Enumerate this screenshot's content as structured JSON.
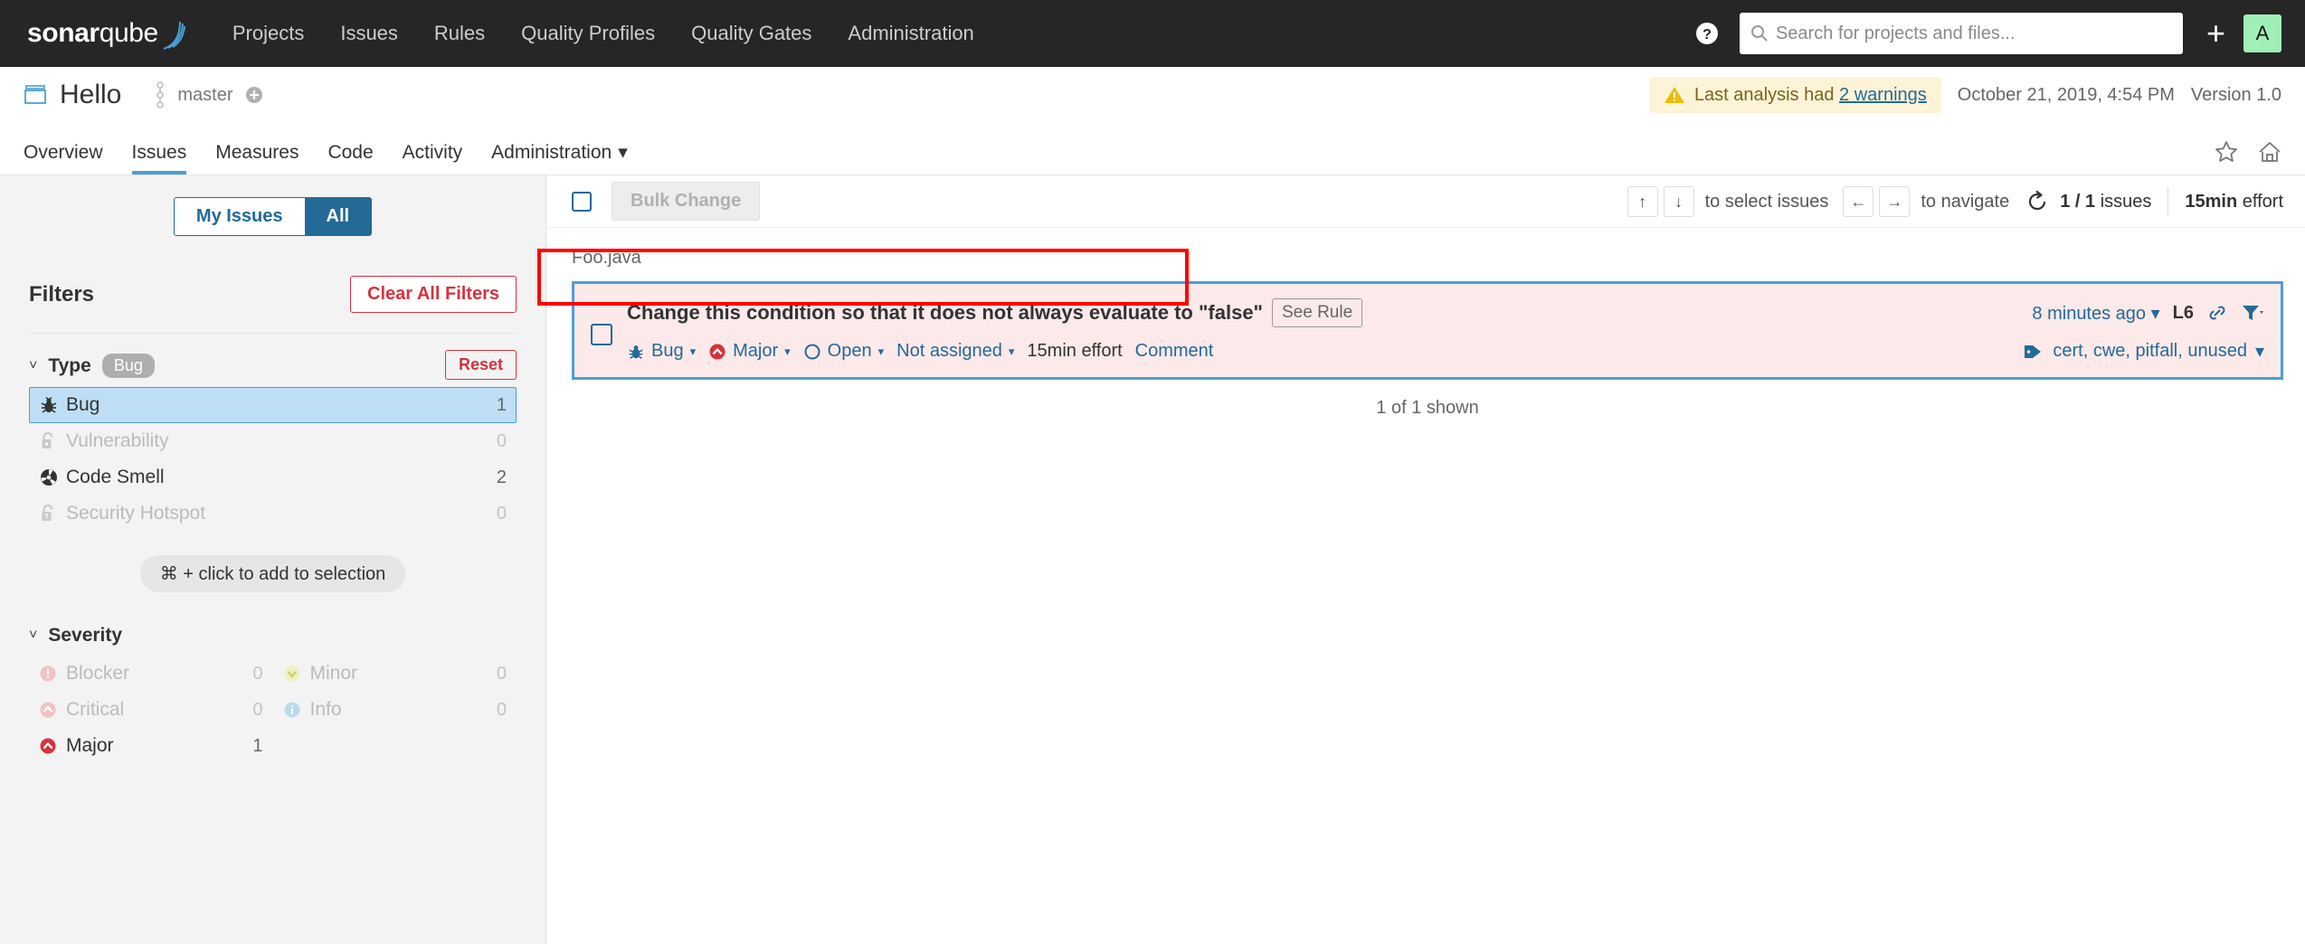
{
  "global_nav": {
    "logo_bold": "sonar",
    "logo_light": "qube",
    "links": [
      {
        "label": "Projects"
      },
      {
        "label": "Issues"
      },
      {
        "label": "Rules"
      },
      {
        "label": "Quality Profiles"
      },
      {
        "label": "Quality Gates"
      },
      {
        "label": "Administration"
      }
    ],
    "help_icon": "help-circle-icon",
    "search": {
      "icon": "search-icon",
      "placeholder": "Search for projects and files...",
      "value": ""
    },
    "plus_label": "+",
    "avatar_initial": "A",
    "avatar_color": "#9ff0b8",
    "background": "#262626"
  },
  "project_header": {
    "icon": "project-icon",
    "title": "Hello",
    "branch_icon": "branch-icon",
    "branch": "master",
    "branch_add_icon": "plus-circle-icon",
    "warning": {
      "icon": "warning-triangle-icon",
      "prefix": "Last analysis had ",
      "link": "2 warnings",
      "bg": "#fdf3d7"
    },
    "analysis_date": "October 21, 2019, 4:54 PM",
    "version": "Version 1.0"
  },
  "tabs": {
    "items": [
      {
        "label": "Overview",
        "active": false
      },
      {
        "label": "Issues",
        "active": true
      },
      {
        "label": "Measures",
        "active": false
      },
      {
        "label": "Code",
        "active": false
      },
      {
        "label": "Activity",
        "active": false
      },
      {
        "label": "Administration",
        "active": false,
        "caret": "▾"
      }
    ],
    "favorite_icon": "star-icon",
    "home_icon": "home-icon",
    "active_color": "#4b9fd5"
  },
  "sidebar": {
    "toggle": {
      "my_issues": "My Issues",
      "all": "All",
      "active": "All",
      "accent": "#236a97"
    },
    "filters_title": "Filters",
    "clear_all": "Clear All Filters",
    "clear_color": "#d4333f",
    "type_facet": {
      "name": "Type",
      "chevron": "˅",
      "chip": "Bug",
      "reset": "Reset",
      "items": [
        {
          "label": "Bug",
          "count": "1",
          "icon": "bug-icon",
          "selected": true,
          "disabled": false
        },
        {
          "label": "Vulnerability",
          "count": "0",
          "icon": "vulnerability-lock-icon",
          "selected": false,
          "disabled": true
        },
        {
          "label": "Code Smell",
          "count": "2",
          "icon": "code-smell-icon",
          "selected": false,
          "disabled": false
        },
        {
          "label": "Security Hotspot",
          "count": "0",
          "icon": "security-hotspot-icon",
          "selected": false,
          "disabled": true
        }
      ]
    },
    "hint": "⌘ + click to add to selection",
    "severity_facet": {
      "name": "Severity",
      "chevron": "˅",
      "items": [
        {
          "label": "Blocker",
          "count": "0",
          "icon": "blocker-icon",
          "disabled": true
        },
        {
          "label": "Minor",
          "count": "0",
          "icon": "minor-icon",
          "disabled": true
        },
        {
          "label": "Critical",
          "count": "0",
          "icon": "critical-icon",
          "disabled": true
        },
        {
          "label": "Info",
          "count": "0",
          "icon": "info-icon",
          "disabled": true
        },
        {
          "label": "Major",
          "count": "1",
          "icon": "major-icon",
          "disabled": false
        }
      ]
    }
  },
  "toolbar": {
    "select_all_checkbox": "",
    "bulk_change": "Bulk Change",
    "key_up": "↑",
    "key_down": "↓",
    "select_hint": "to select issues",
    "key_left": "←",
    "key_right": "→",
    "navigate_hint": "to navigate",
    "reload_icon": "reload-icon",
    "issues_count": "1 / 1",
    "issues_word": "issues",
    "effort_value": "15min",
    "effort_word": "effort"
  },
  "issue_list": {
    "file_name": "Foo.java",
    "issue": {
      "message": "Change this condition so that it does not always evaluate to \"false\"",
      "see_rule": "See Rule",
      "updated": "8 minutes ago",
      "line": "L6",
      "permalink_icon": "link-icon",
      "filter_icon": "filter-icon",
      "type": {
        "label": "Bug",
        "icon": "bug-icon"
      },
      "severity": {
        "label": "Major",
        "icon": "major-icon"
      },
      "status": {
        "label": "Open",
        "icon": "open-circle-icon"
      },
      "assignee": "Not assigned",
      "effort": "15min effort",
      "comment": "Comment",
      "tags_icon": "tag-icon",
      "tags": "cert, cwe, pitfall, unused",
      "caret": "▾",
      "border_color": "#4b9fd5",
      "bg_color": "#fce9e9"
    },
    "shown_note": "1 of 1 shown",
    "annotation_color": "#ff0000"
  }
}
